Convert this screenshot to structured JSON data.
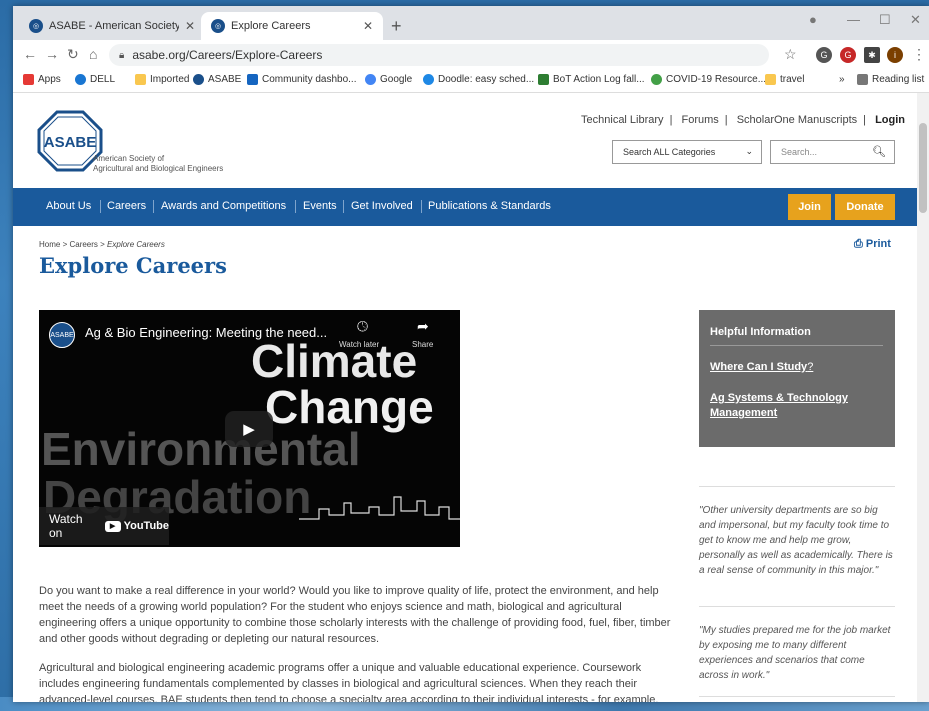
{
  "browser": {
    "tabs": [
      {
        "title": "ASABE - American Society of Agr",
        "active": false
      },
      {
        "title": "Explore Careers",
        "active": true
      }
    ],
    "url": "asabe.org/Careers/Explore-Careers",
    "bookmarks": [
      "Apps",
      "DELL",
      "Imported",
      "ASABE",
      "Community dashbo...",
      "Google",
      "Doodle: easy sched...",
      "BoT Action Log fall...",
      "COVID-19 Resource...",
      "travel",
      "»",
      "Reading list"
    ]
  },
  "site": {
    "logo_text": "ASABE",
    "org_line1": "American Society of",
    "org_line2": "Agricultural and Biological Engineers",
    "top_links": [
      "Technical Library",
      "Forums",
      "ScholarOne Manuscripts",
      "Login"
    ],
    "category_select": "Search ALL Categories",
    "search_placeholder": "Search...",
    "nav": [
      "About Us",
      "Careers",
      "Awards and Competitions",
      "Events",
      "Get Involved",
      "Publications & Standards"
    ],
    "join_label": "Join",
    "donate_label": "Donate"
  },
  "page": {
    "breadcrumb_home": "Home",
    "breadcrumb_careers": "Careers",
    "breadcrumb_current": "Explore Careers",
    "print_label": "Print",
    "title": "Explore Careers",
    "video": {
      "title": "Ag & Bio Engineering: Meeting the need...",
      "watch_later": "Watch later",
      "share": "Share",
      "overlay_words": [
        "Climate",
        "Change",
        "Environmental",
        "Degradation"
      ],
      "watch_on": "Watch on",
      "youtube": "YouTube"
    },
    "paragraphs": [
      "Do you want to make a real difference in your world? Would you like to improve quality of life, protect the environment, and help meet the needs of a growing world population? For the student who enjoys science and math, biological and agricultural engineering offers a unique opportunity to combine those scholarly interests with the challenge of providing food, fuel, fiber, timber and other goods without degrading or depleting our natural resources.",
      "Agricultural and biological engineering academic programs offer a unique and valuable educational experience. Coursework includes engineering fundamentals complemented by classes in biological and agricultural sciences. When they reach their advanced-level courses, BAE students then tend to choose a specialty area according to their individual interests - for example,"
    ]
  },
  "sidebar": {
    "heading": "Helpful Information",
    "link1": "Where Can I Study",
    "link1_suffix": "?",
    "link2": "Ag Systems & Technology Management",
    "quote1": "\"Other university departments are so big and impersonal, but my faculty took time to get to know me and help me grow, personally as well as academically. There is a real sense of community in this major.\"",
    "quote2": "\"My studies prepared me for the job market by exposing me to many different experiences and scenarios that come across in work.\""
  }
}
